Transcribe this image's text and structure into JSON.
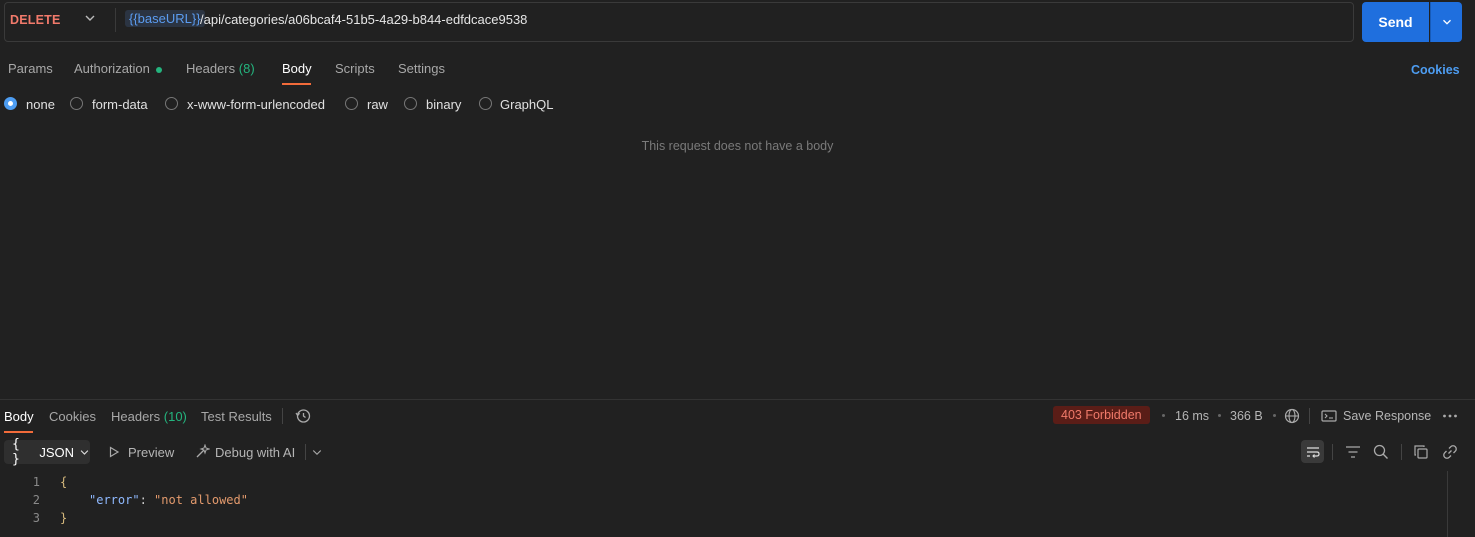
{
  "request": {
    "method": "DELETE",
    "url_variable": "{{baseURL}}",
    "url_path": "/api/categories/a06bcaf4-51b5-4a29-b844-edfdcace9538",
    "send_label": "Send"
  },
  "request_tabs": {
    "params": "Params",
    "authorization": "Authorization",
    "headers": "Headers",
    "headers_count": "(8)",
    "body": "Body",
    "scripts": "Scripts",
    "settings": "Settings",
    "cookies": "Cookies",
    "active": "Body"
  },
  "body_types": {
    "none": "none",
    "form_data": "form-data",
    "urlencoded": "x-www-form-urlencoded",
    "raw": "raw",
    "binary": "binary",
    "graphql": "GraphQL",
    "selected": "none"
  },
  "body_empty_message": "This request does not have a body",
  "response": {
    "tabs": {
      "body": "Body",
      "cookies": "Cookies",
      "headers": "Headers",
      "headers_count": "(10)",
      "test_results": "Test Results"
    },
    "status": "403 Forbidden",
    "time": "16 ms",
    "size": "366 B",
    "save_response": "Save Response",
    "format": "JSON",
    "format_braces": "{ }",
    "preview": "Preview",
    "debug_ai": "Debug with AI",
    "code": {
      "line_numbers": [
        "1",
        "2",
        "3"
      ],
      "open_brace": "{",
      "key": "\"error\"",
      "colon": ":",
      "value": "\"not allowed\"",
      "close_brace": "}"
    }
  },
  "colors": {
    "background": "#212121",
    "accent_blue": "#1f6fde",
    "method_red": "#f27a6b",
    "tab_underline": "#f26b3a",
    "status_error_bg": "#5a1d17",
    "success_green": "#24b47e"
  }
}
